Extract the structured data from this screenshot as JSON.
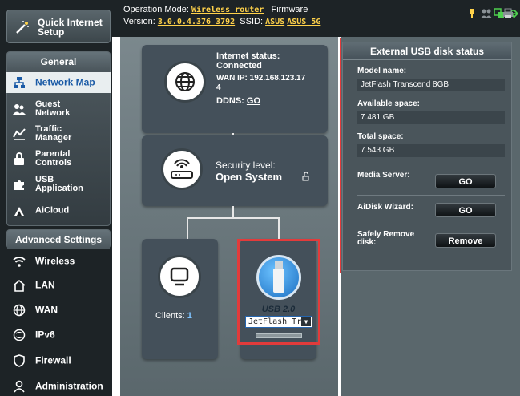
{
  "sidebar": {
    "quick_setup": "Quick Internet Setup",
    "general_header": "General",
    "general_items": [
      {
        "label": "Network Map",
        "icon": "network-map-icon"
      },
      {
        "label": "Guest Network",
        "icon": "guest-network-icon"
      },
      {
        "label": "Traffic Manager",
        "icon": "traffic-manager-icon"
      },
      {
        "label": "Parental Controls",
        "icon": "parental-controls-icon"
      },
      {
        "label": "USB Application",
        "icon": "usb-application-icon"
      },
      {
        "label": "AiCloud",
        "icon": "aicloud-icon"
      }
    ],
    "advanced_header": "Advanced Settings",
    "advanced_items": [
      {
        "label": "Wireless",
        "icon": "wireless-icon"
      },
      {
        "label": "LAN",
        "icon": "lan-icon"
      },
      {
        "label": "WAN",
        "icon": "wan-icon"
      },
      {
        "label": "IPv6",
        "icon": "ipv6-icon"
      },
      {
        "label": "Firewall",
        "icon": "firewall-icon"
      },
      {
        "label": "Administration",
        "icon": "administration-icon"
      }
    ]
  },
  "topbar": {
    "op_mode_label": "Operation Mode:",
    "op_mode_value": "Wireless router",
    "firmware_label": "Firmware",
    "version_label": "Version:",
    "version_value": "3.0.0.4.376_3792",
    "ssid_label": "SSID:",
    "ssid_1": "ASUS",
    "ssid_2": "ASUS_5G"
  },
  "map": {
    "internet_status_label": "Internet status:",
    "internet_status_value": "Connected",
    "wan_ip": "WAN IP: 192.168.123.17",
    "wan_ip_cont": "4",
    "ddns_label": "DDNS:",
    "ddns_value": "GO",
    "security_label": "Security level:",
    "security_value": "Open System",
    "clients_label": "Clients:",
    "clients_count": "1",
    "usb_label": "USB 2.0",
    "usb_device": "JetFlash Tr"
  },
  "usb_panel": {
    "title": "External USB disk status",
    "model_label": "Model name:",
    "model_value": "JetFlash Transcend 8GB",
    "avail_label": "Available space:",
    "avail_value": "7.481 GB",
    "total_label": "Total space:",
    "total_value": "7.543 GB",
    "media_label": "Media Server:",
    "media_btn": "GO",
    "aidisk_label": "AiDisk Wizard:",
    "aidisk_btn": "GO",
    "safely_label_1": "Safely Remove",
    "safely_label_2": "disk:",
    "remove_btn": "Remove"
  },
  "colors": {
    "accent_highlight": "#e23b3b",
    "link_yellow": "#ffd24a",
    "active_blue": "#1a5aa6"
  }
}
